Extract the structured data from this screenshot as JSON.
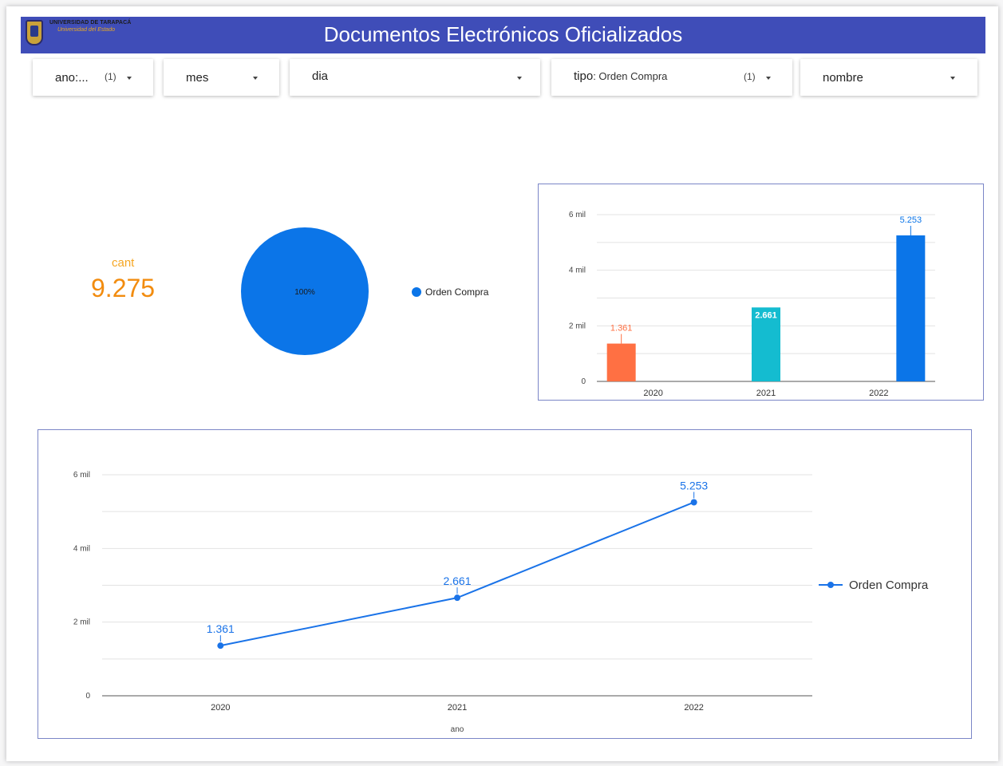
{
  "header": {
    "title": "Documentos Electrónicos Oficializados",
    "logo_name": "UNIVERSIDAD DE TARAPACÁ",
    "logo_subtitle": "Universidad del Estado",
    "logo_icon": "university-crest-icon"
  },
  "filters": [
    {
      "label": "ano:...",
      "value": "",
      "count": "(1)"
    },
    {
      "label": "mes",
      "value": "",
      "count": ""
    },
    {
      "label": "dia",
      "value": "",
      "count": ""
    },
    {
      "label": "tipo",
      "value": ": Orden Compra",
      "count": "(1)"
    },
    {
      "label": "nombre",
      "value": "",
      "count": ""
    }
  ],
  "kpi": {
    "label": "cant",
    "value": "9.275",
    "color": "#f28c0f"
  },
  "pie": {
    "slice_label": "100%",
    "legend": "Orden Compra",
    "color": "#0b75e8"
  },
  "chart_data": [
    {
      "type": "pie",
      "categories": [
        "Orden Compra"
      ],
      "values": [
        100
      ],
      "labels": [
        "100%"
      ]
    },
    {
      "type": "bar",
      "categories": [
        "2020",
        "2021",
        "2022"
      ],
      "values": [
        1361,
        2661,
        5253
      ],
      "data_labels": [
        "1.361",
        "2.661",
        "5.253"
      ],
      "colors": [
        "#ff7043",
        "#14bcd0",
        "#0b75e8"
      ],
      "yticks": [
        {
          "v": 0,
          "t": "0"
        },
        {
          "v": 2000,
          "t": "2 mil"
        },
        {
          "v": 4000,
          "t": "4 mil"
        },
        {
          "v": 6000,
          "t": "6 mil"
        }
      ],
      "ylim": [
        0,
        6000
      ],
      "grid": true
    },
    {
      "type": "line",
      "x": [
        "2020",
        "2021",
        "2022"
      ],
      "series": [
        {
          "name": "Orden Compra",
          "values": [
            1361,
            2661,
            5253
          ],
          "data_labels": [
            "1.361",
            "2.661",
            "5.253"
          ],
          "color": "#1a73e8"
        }
      ],
      "xlabel": "ano",
      "yticks": [
        {
          "v": 0,
          "t": "0"
        },
        {
          "v": 2000,
          "t": "2 mil"
        },
        {
          "v": 4000,
          "t": "4 mil"
        },
        {
          "v": 6000,
          "t": "6 mil"
        }
      ],
      "ylim": [
        0,
        6000
      ],
      "grid": true,
      "legend": "right"
    }
  ]
}
